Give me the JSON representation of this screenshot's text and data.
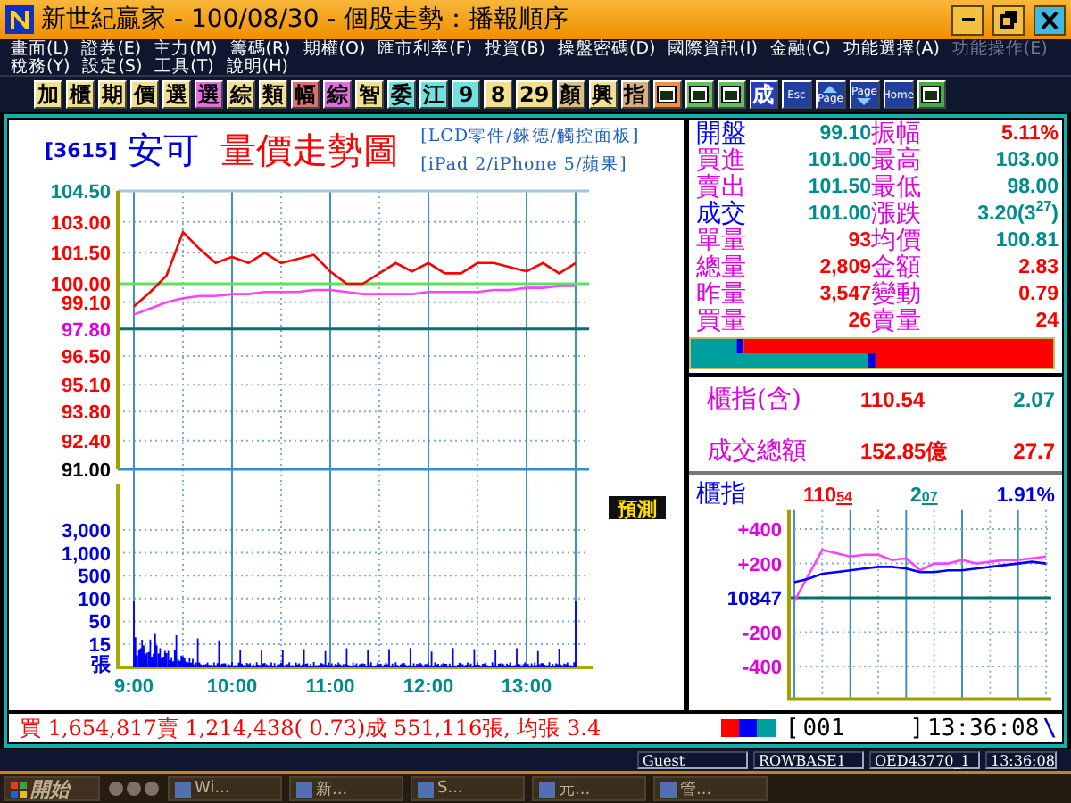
{
  "window": {
    "title": "新世紀贏家 - 100/08/30 - 個股走勢：播報順序"
  },
  "menu": {
    "rows": [
      [
        {
          "label": "畫面(L)",
          "disabled": false
        },
        {
          "label": "證券(E)",
          "disabled": false
        },
        {
          "label": "主力(M)",
          "disabled": false
        },
        {
          "label": "籌碼(R)",
          "disabled": false
        },
        {
          "label": "期權(O)",
          "disabled": false
        },
        {
          "label": "匯市利率(F)",
          "disabled": false
        },
        {
          "label": "投資(B)",
          "disabled": false
        },
        {
          "label": "操盤密碼(D)",
          "disabled": false
        },
        {
          "label": "國際資訊(I)",
          "disabled": false
        },
        {
          "label": "金融(C)",
          "disabled": false
        },
        {
          "label": "功能選擇(A)",
          "disabled": false
        },
        {
          "label": "功能操作(E)",
          "disabled": true
        }
      ],
      [
        {
          "label": "稅務(Y)",
          "disabled": false
        },
        {
          "label": "設定(S)",
          "disabled": false
        },
        {
          "label": "工具(T)",
          "disabled": false
        },
        {
          "label": "說明(H)",
          "disabled": false
        }
      ]
    ]
  },
  "toolbar": {
    "buttons": [
      {
        "kind": "text",
        "label": "加",
        "color": "#f0e090"
      },
      {
        "kind": "text",
        "label": "櫃",
        "color": "#f0e090"
      },
      {
        "kind": "text",
        "label": "期",
        "color": "#f0e090"
      },
      {
        "kind": "text",
        "label": "價",
        "color": "#f0e090"
      },
      {
        "kind": "text",
        "label": "選",
        "color": "#f0e090"
      },
      {
        "kind": "text",
        "label": "選",
        "color": "#e070e0"
      },
      {
        "kind": "text",
        "label": "綜",
        "color": "#f0e090"
      },
      {
        "kind": "text",
        "label": "類",
        "color": "#f0e090"
      },
      {
        "kind": "text",
        "label": "幅",
        "color": "#e07070"
      },
      {
        "kind": "text",
        "label": "綜",
        "color": "#e070e0"
      },
      {
        "kind": "text",
        "label": "智",
        "color": "#f0e090"
      },
      {
        "kind": "text",
        "label": "委",
        "color": "#70e0e0"
      },
      {
        "kind": "text",
        "label": "江",
        "color": "#70e0e0"
      },
      {
        "kind": "text",
        "label": "9",
        "color": "#70e0e0"
      },
      {
        "kind": "text",
        "label": "8",
        "color": "#f0e090"
      },
      {
        "kind": "text",
        "label": "29",
        "color": "#f0e090"
      },
      {
        "kind": "text",
        "label": "顏",
        "color": "#d8c080"
      },
      {
        "kind": "text",
        "label": "興",
        "color": "#f0e090"
      },
      {
        "kind": "text",
        "label": "指",
        "color": "#d8b080"
      },
      {
        "kind": "image",
        "color": "#f09040"
      },
      {
        "kind": "image",
        "color": "#60c060"
      },
      {
        "kind": "image",
        "color": "#60c060"
      },
      {
        "kind": "text",
        "label": "成",
        "color": "#2040c0"
      },
      {
        "kind": "key",
        "label": "Esc",
        "color": "#2040a0"
      },
      {
        "kind": "pageup",
        "label": "Page",
        "color": "#2040a0"
      },
      {
        "kind": "pagedown",
        "label": "Page",
        "color": "#2040a0"
      },
      {
        "kind": "key",
        "label": "Home",
        "color": "#2040a0"
      },
      {
        "kind": "image",
        "color": "#40b040"
      }
    ]
  },
  "stock": {
    "code": "[3615]",
    "name": "安可",
    "chart_title": "量價走勢圖",
    "tags": [
      "[LCD零件/錸德/觸控面板]",
      "[iPad 2/iPhone 5/蘋果]"
    ]
  },
  "price_chart": {
    "chart_data": {
      "type": "line",
      "grid": true,
      "ref_lines": [
        {
          "axis": "y",
          "value": 100,
          "color": "#60e060"
        },
        {
          "axis": "y",
          "value": 97.8,
          "color": "#007070"
        }
      ],
      "categories": [
        null,
        null,
        null,
        null,
        null,
        null,
        null,
        null,
        null,
        null,
        null,
        null,
        null,
        null,
        null,
        null,
        null,
        null,
        null,
        null,
        null,
        null,
        null,
        null,
        null,
        null,
        null,
        null
      ],
      "series": [
        {
          "color": "#ff0000",
          "values": [
            98.9,
            99.6,
            100.4,
            102.5,
            101.7,
            101.0,
            101.3,
            101.0,
            101.5,
            101.0,
            101.2,
            101.4,
            100.6,
            100.0,
            100.0,
            100.5,
            101.0,
            100.6,
            101.0,
            100.5,
            100.5,
            101.0,
            101.0,
            100.8,
            100.6,
            101.0,
            100.5,
            101.0
          ]
        },
        {
          "color": "#ff40ff",
          "values": [
            98.5,
            98.8,
            99.1,
            99.3,
            99.4,
            99.4,
            99.5,
            99.5,
            99.6,
            99.6,
            99.6,
            99.7,
            99.7,
            99.6,
            99.5,
            99.5,
            99.5,
            99.5,
            99.6,
            99.6,
            99.6,
            99.6,
            99.7,
            99.7,
            99.8,
            99.8,
            99.9,
            99.9
          ]
        }
      ],
      "ylim": [
        91,
        104.5
      ],
      "yticks": [
        {
          "value": 104.5,
          "label": "104.50"
        },
        {
          "value": 103,
          "label": "103.00"
        },
        {
          "value": 101.5,
          "label": "101.50"
        },
        {
          "value": 100,
          "label": "100.00"
        },
        {
          "value": 99.1,
          "label": "99.10"
        },
        {
          "value": 97.8,
          "label": "97.80"
        },
        {
          "value": 96.5,
          "label": "96.50"
        },
        {
          "value": 95.1,
          "label": "95.10"
        },
        {
          "value": 93.8,
          "label": "93.80"
        },
        {
          "value": 92.4,
          "label": "92.40"
        },
        {
          "value": 91,
          "label": "91.00"
        }
      ]
    },
    "tick_colors": [
      {
        "color": "#008c8c"
      },
      {
        "color": "#ff0000"
      },
      {
        "color": "#ff0000"
      },
      {
        "color": "#ff0000"
      },
      {
        "color": "#ff0000"
      },
      {
        "color": "#e000e0"
      },
      {
        "color": "#ff0000"
      },
      {
        "color": "#ff0000"
      },
      {
        "color": "#ff0000"
      },
      {
        "color": "#ff0000"
      },
      {
        "color": "#000000"
      }
    ]
  },
  "forecast_button": {
    "label": "預測"
  },
  "volume": {
    "ticks": [
      "3,000",
      "1,000",
      "500",
      "100",
      "50",
      "15"
    ],
    "unit": "張",
    "time_labels": [
      "9:00",
      "10:00",
      "11:00",
      "12:00",
      "13:00"
    ]
  },
  "quote": {
    "rows": [
      {
        "left": {
          "label": {
            "text": "開盤",
            "color": "#0000ff"
          },
          "value": {
            "text": "99.10",
            "color": "#008c8c"
          }
        },
        "right": {
          "label": {
            "text": "振幅",
            "color": "#e000e0"
          },
          "value": {
            "text": "5.11%",
            "color": "#ff0000"
          }
        }
      },
      {
        "left": {
          "label": {
            "text": "買進",
            "color": "#e000e0"
          },
          "value": {
            "text": "101.00",
            "color": "#008c8c"
          }
        },
        "right": {
          "label": {
            "text": "最高",
            "color": "#e000e0"
          },
          "value": {
            "text": "103.00",
            "color": "#008c8c"
          }
        }
      },
      {
        "left": {
          "label": {
            "text": "賣出",
            "color": "#e000e0"
          },
          "value": {
            "text": "101.50",
            "color": "#008c8c"
          }
        },
        "right": {
          "label": {
            "text": "最低",
            "color": "#e000e0"
          },
          "value": {
            "text": "98.00",
            "color": "#008c8c"
          }
        }
      },
      {
        "left": {
          "label": {
            "text": "成交",
            "color": "#0000ff"
          },
          "value": {
            "text": "101.00",
            "color": "#008c8c"
          }
        },
        "right": {
          "label": {
            "text": "漲跌",
            "color": "#e000e0"
          },
          "value": {
            "text": "3.20(3$^{27}$)",
            "color": "#008c8c"
          }
        }
      },
      {
        "left": {
          "label": {
            "text": "單量",
            "color": "#e000e0"
          },
          "value": {
            "text": "93",
            "color": "#ff0000"
          }
        },
        "right": {
          "label": {
            "text": "均價",
            "color": "#e000e0"
          },
          "value": {
            "text": "100.81",
            "color": "#008c8c"
          }
        }
      },
      {
        "left": {
          "label": {
            "text": "總量",
            "color": "#e000e0"
          },
          "value": {
            "text": "2,809",
            "color": "#ff0000"
          }
        },
        "right": {
          "label": {
            "text": "金額",
            "color": "#e000e0"
          },
          "value": {
            "text": "2.83",
            "color": "#ff0000"
          }
        }
      },
      {
        "left": {
          "label": {
            "text": "昨量",
            "color": "#e000e0"
          },
          "value": {
            "text": "3,547",
            "color": "#ff0000"
          }
        },
        "right": {
          "label": {
            "text": "變動",
            "color": "#e000e0"
          },
          "value": {
            "text": "0.79",
            "color": "#ff0000"
          }
        }
      },
      {
        "left": {
          "label": {
            "text": "買量",
            "color": "#e000e0"
          },
          "value": {
            "text": "26",
            "color": "#ff0000"
          }
        },
        "right": {
          "label": {
            "text": "賣量",
            "color": "#e000e0"
          },
          "value": {
            "text": "24",
            "color": "#ff0000"
          }
        }
      }
    ]
  },
  "otc_box": {
    "rows": [
      {
        "label": "櫃指(含)",
        "value": "110.54",
        "change": {
          "text": "2.07",
          "color": "#008c8c"
        }
      },
      {
        "label": "成交總額",
        "value": "152.85億",
        "change": {
          "text": "27.7",
          "color": "#ff0000"
        }
      }
    ]
  },
  "index": {
    "label": "櫃指",
    "value": "110$_{54}$",
    "change": "2$_{07}$",
    "percent": "1.91%",
    "base_label": "10847",
    "chart_data": {
      "type": "line",
      "grid": true,
      "ref_lines": [
        {
          "axis": "y",
          "value": 0,
          "color": "#007070"
        }
      ],
      "categories": [
        null,
        null,
        null,
        null,
        null,
        null,
        null,
        null,
        null,
        null,
        null,
        null,
        null,
        null,
        null,
        null,
        null,
        null,
        null
      ],
      "series": [
        {
          "color": "#ff40ff",
          "values": [
            -20,
            130,
            280,
            260,
            240,
            250,
            250,
            220,
            230,
            160,
            200,
            200,
            220,
            200,
            210,
            220,
            220,
            230,
            240
          ]
        },
        {
          "color": "#0000ff",
          "values": [
            90,
            110,
            140,
            150,
            160,
            170,
            180,
            180,
            170,
            150,
            150,
            160,
            160,
            170,
            180,
            190,
            200,
            210,
            200
          ]
        }
      ],
      "ylim": [
        -590,
        510
      ],
      "yticks": [
        {
          "value": 400,
          "label": "+400"
        },
        {
          "value": 200,
          "label": "+200"
        },
        {
          "value": -200,
          "label": "-200"
        },
        {
          "value": -400,
          "label": "-400"
        }
      ]
    }
  },
  "status_line": {
    "summary": "買 1,654,817賣 1,214,438( 0.73)成 551,116張, 均張 3.4",
    "command": {
      "open": "[",
      "value": "001",
      "close": "]"
    },
    "clock": "13:36:08",
    "marker": "\\"
  },
  "status_bar": {
    "cells": [
      "Guest",
      "ROWBASE1",
      "OED43770_1",
      "13:36:08"
    ]
  },
  "taskbar": {
    "start": "開始",
    "tasks": [
      "Wi...",
      "新...",
      "S...",
      "元...",
      "管..."
    ]
  }
}
